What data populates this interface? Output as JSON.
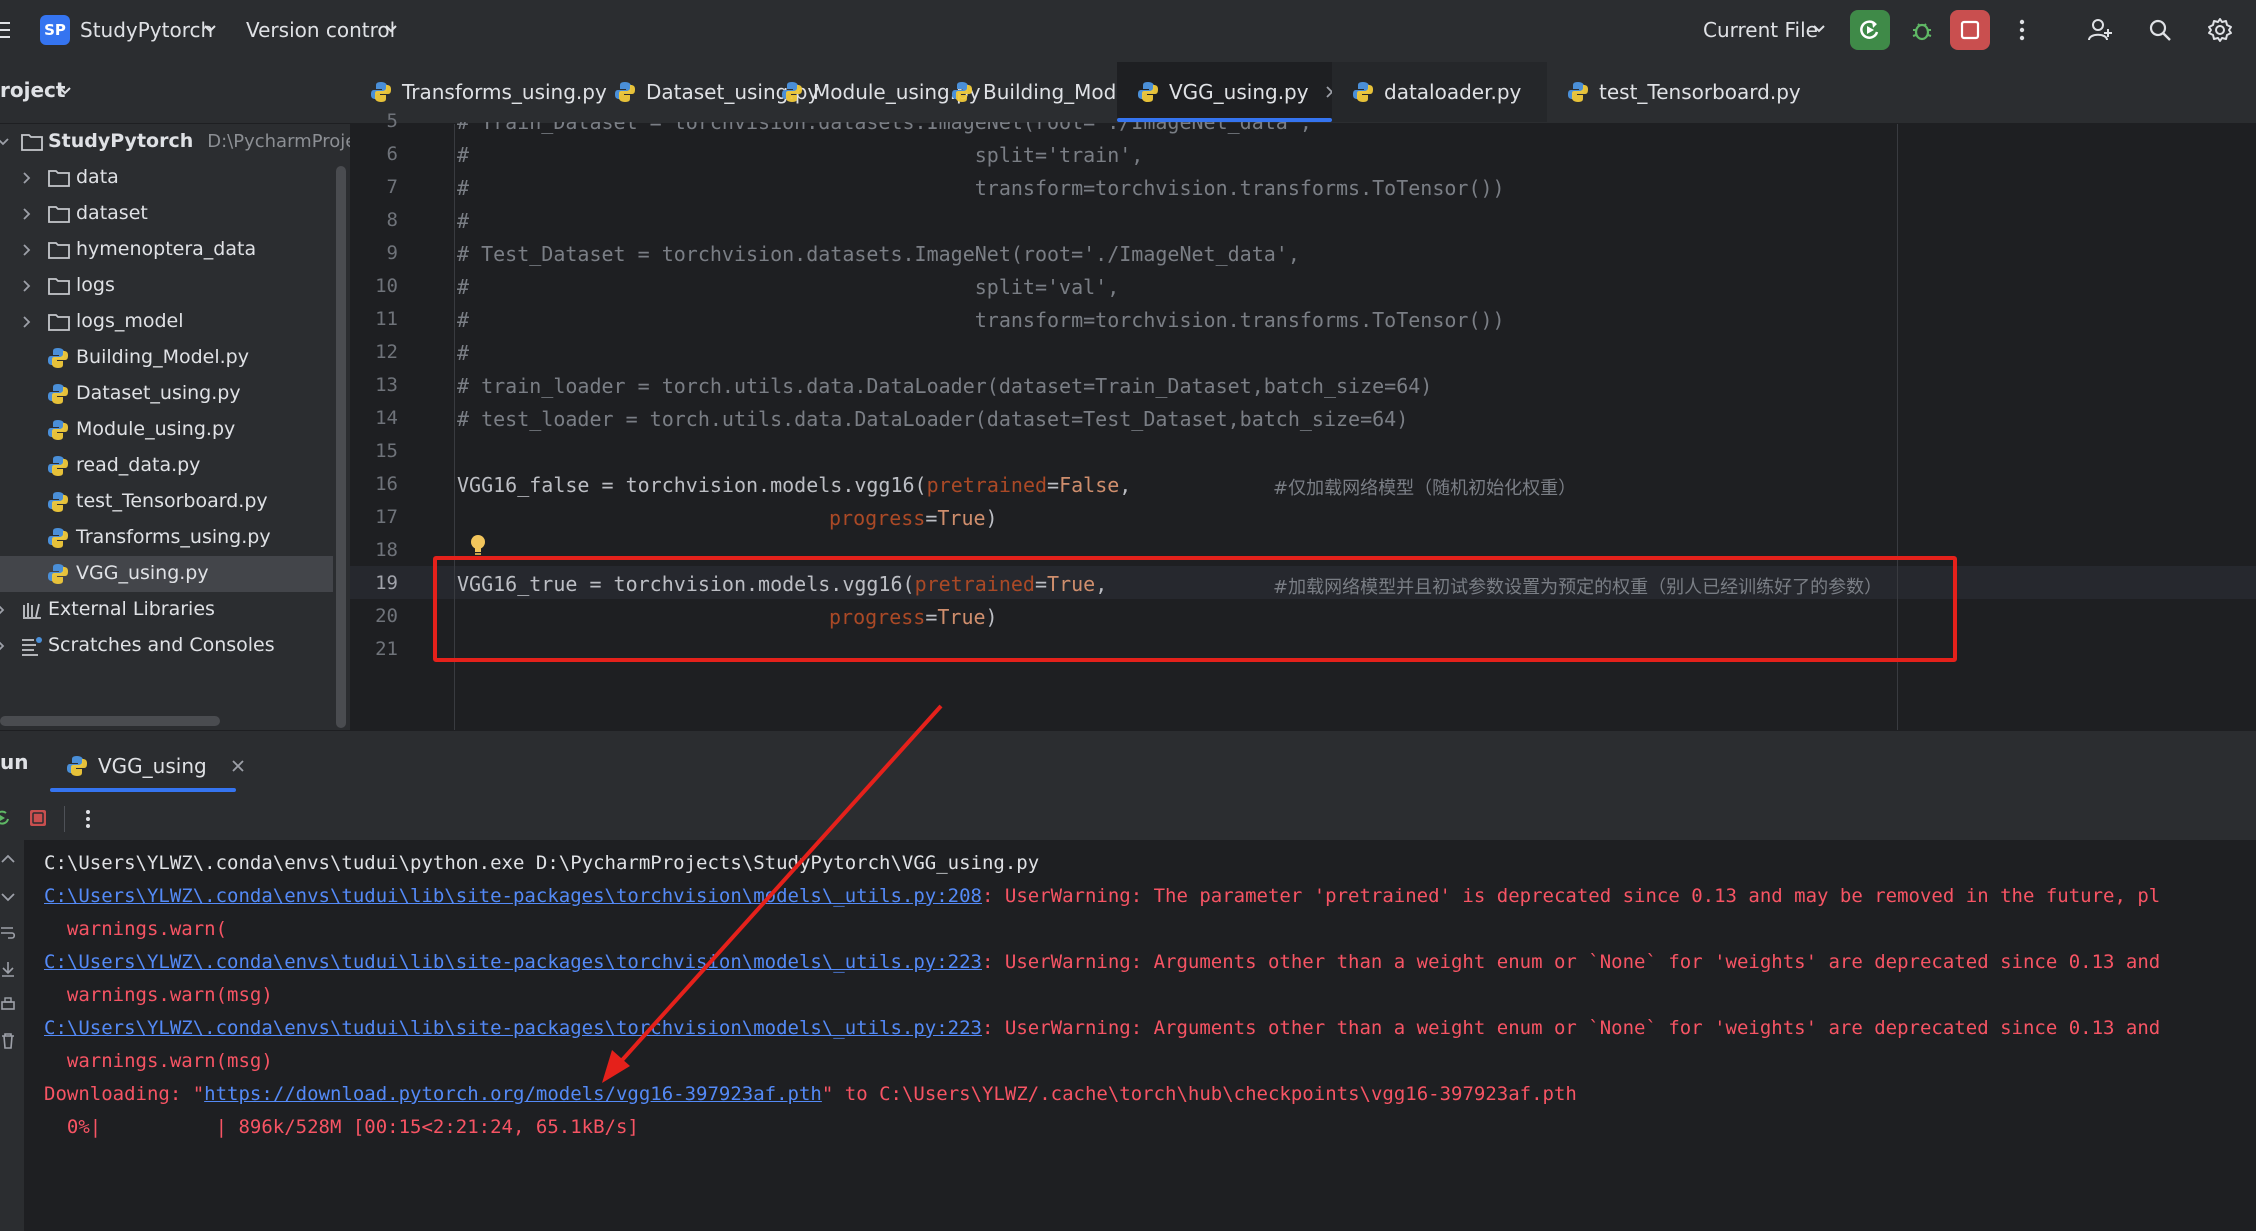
{
  "titlebar": {
    "project_badge": "SP",
    "project_name": "StudyPytorch",
    "vcs_label": "Version control",
    "run_config": "Current File"
  },
  "tool_window": {
    "title": "roject"
  },
  "tabs": [
    {
      "label": "Transforms_using.py"
    },
    {
      "label": "Dataset_using.py"
    },
    {
      "label": "Module_using.py"
    },
    {
      "label": "Building_Model.py"
    },
    {
      "label": "VGG_using.py"
    },
    {
      "label": "dataloader.py"
    },
    {
      "label": "test_Tensorboard.py"
    }
  ],
  "tree": {
    "root": {
      "label": "StudyPytorch",
      "path": "D:\\PycharmProjects\\"
    },
    "folders": [
      "data",
      "dataset",
      "hymenoptera_data",
      "logs",
      "logs_model"
    ],
    "files": [
      "Building_Model.py",
      "Dataset_using.py",
      "Module_using.py",
      "read_data.py",
      "test_Tensorboard.py",
      "Transforms_using.py",
      "VGG_using.py"
    ],
    "external": "External Libraries",
    "scratches": "Scratches and Consoles"
  },
  "editor": {
    "lines": [
      {
        "n": "5",
        "text": "# Train_Dataset = torchvision.datasets.ImageNet(root='./ImageNet_data',"
      },
      {
        "n": "6",
        "text": "#                                          split='train',"
      },
      {
        "n": "7",
        "text": "#                                          transform=torchvision.transforms.ToTensor())"
      },
      {
        "n": "8",
        "text": "#"
      },
      {
        "n": "9",
        "text": "# Test_Dataset = torchvision.datasets.ImageNet(root='./ImageNet_data',"
      },
      {
        "n": "10",
        "text": "#                                          split='val',"
      },
      {
        "n": "11",
        "text": "#                                          transform=torchvision.transforms.ToTensor())"
      },
      {
        "n": "12",
        "text": "#"
      },
      {
        "n": "13",
        "text": "# train_loader = torch.utils.data.DataLoader(dataset=Train_Dataset,batch_size=64)"
      },
      {
        "n": "14",
        "text": "# test_loader = torch.utils.data.DataLoader(dataset=Test_Dataset,batch_size=64)"
      },
      {
        "n": "15",
        "text": ""
      },
      {
        "n": "16",
        "text": ""
      },
      {
        "n": "17",
        "text": ""
      },
      {
        "n": "18",
        "text": ""
      },
      {
        "n": "19",
        "text": ""
      },
      {
        "n": "20",
        "text": ""
      },
      {
        "n": "21",
        "text": ""
      }
    ],
    "l16": {
      "a": "VGG16_false = torchvision.models.vgg16(",
      "kw": "pretrained",
      "eq": "=",
      "val": "False",
      "end": ",",
      "comment": "#仅加载网络模型（随机初始化权重）"
    },
    "l17": {
      "kw": "progress",
      "eq": "=",
      "val": "True",
      "end": ")"
    },
    "l19": {
      "a": "VGG16_true = torchvision.models.vgg16(",
      "kw": "pretrained",
      "eq": "=",
      "val": "True",
      "end": ",",
      "comment": "#加载网络模型并且初试参数设置为预定的权重（别人已经训练好了的参数）"
    },
    "l20": {
      "kw": "progress",
      "eq": "=",
      "val": "True",
      "end": ")"
    }
  },
  "run": {
    "title": "un",
    "tab_label": "VGG_using",
    "console": {
      "l1": "C:\\Users\\YLWZ\\.conda\\envs\\tudui\\python.exe D:\\PycharmProjects\\StudyPytorch\\VGG_using.py",
      "l2_link": "C:\\Users\\YLWZ\\.conda\\envs\\tudui\\lib\\site-packages\\torchvision\\models\\_utils.py:208",
      "l2_msg": ": UserWarning: The parameter 'pretrained' is deprecated since 0.13 and may be removed in the future, pl",
      "l3": "  warnings.warn(",
      "l4_link": "C:\\Users\\YLWZ\\.conda\\envs\\tudui\\lib\\site-packages\\torchvision\\models\\_utils.py:223",
      "l4_msg": ": UserWarning: Arguments other than a weight enum or `None` for 'weights' are deprecated since 0.13 and",
      "l5": "  warnings.warn(msg)",
      "l6_link": "C:\\Users\\YLWZ\\.conda\\envs\\tudui\\lib\\site-packages\\torchvision\\models\\_utils.py:223",
      "l6_msg": ": UserWarning: Arguments other than a weight enum or `None` for 'weights' are deprecated since 0.13 and",
      "l7": "  warnings.warn(msg)",
      "l8_a": "Downloading: \"",
      "l8_link": "https://download.pytorch.org/models/vgg16-397923af.pth",
      "l8_b": "\" to C:\\Users\\YLWZ/.cache\\torch\\hub\\checkpoints\\vgg16-397923af.pth",
      "l9": "  0%|          | 896k/528M [00:15<2:21:24, 65.1kB/s]"
    }
  },
  "colors": {
    "accent": "#3574f0",
    "annotation_red": "#e5211b",
    "error_text": "#f75464",
    "link": "#548af7",
    "run_green": "#3f8a48",
    "stop_red": "#c94f4f"
  }
}
